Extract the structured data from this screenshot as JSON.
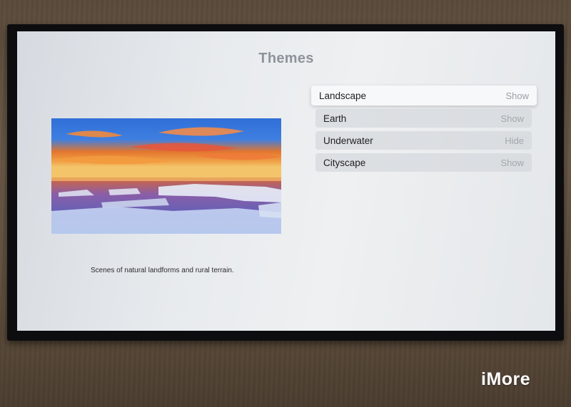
{
  "screen": {
    "title": "Themes",
    "description": "Scenes of natural landforms and rural terrain."
  },
  "themes": [
    {
      "label": "Landscape",
      "value": "Show",
      "focused": true
    },
    {
      "label": "Earth",
      "value": "Show",
      "focused": false
    },
    {
      "label": "Underwater",
      "value": "Hide",
      "focused": false
    },
    {
      "label": "Cityscape",
      "value": "Show",
      "focused": false
    }
  ],
  "watermark": "iMore"
}
